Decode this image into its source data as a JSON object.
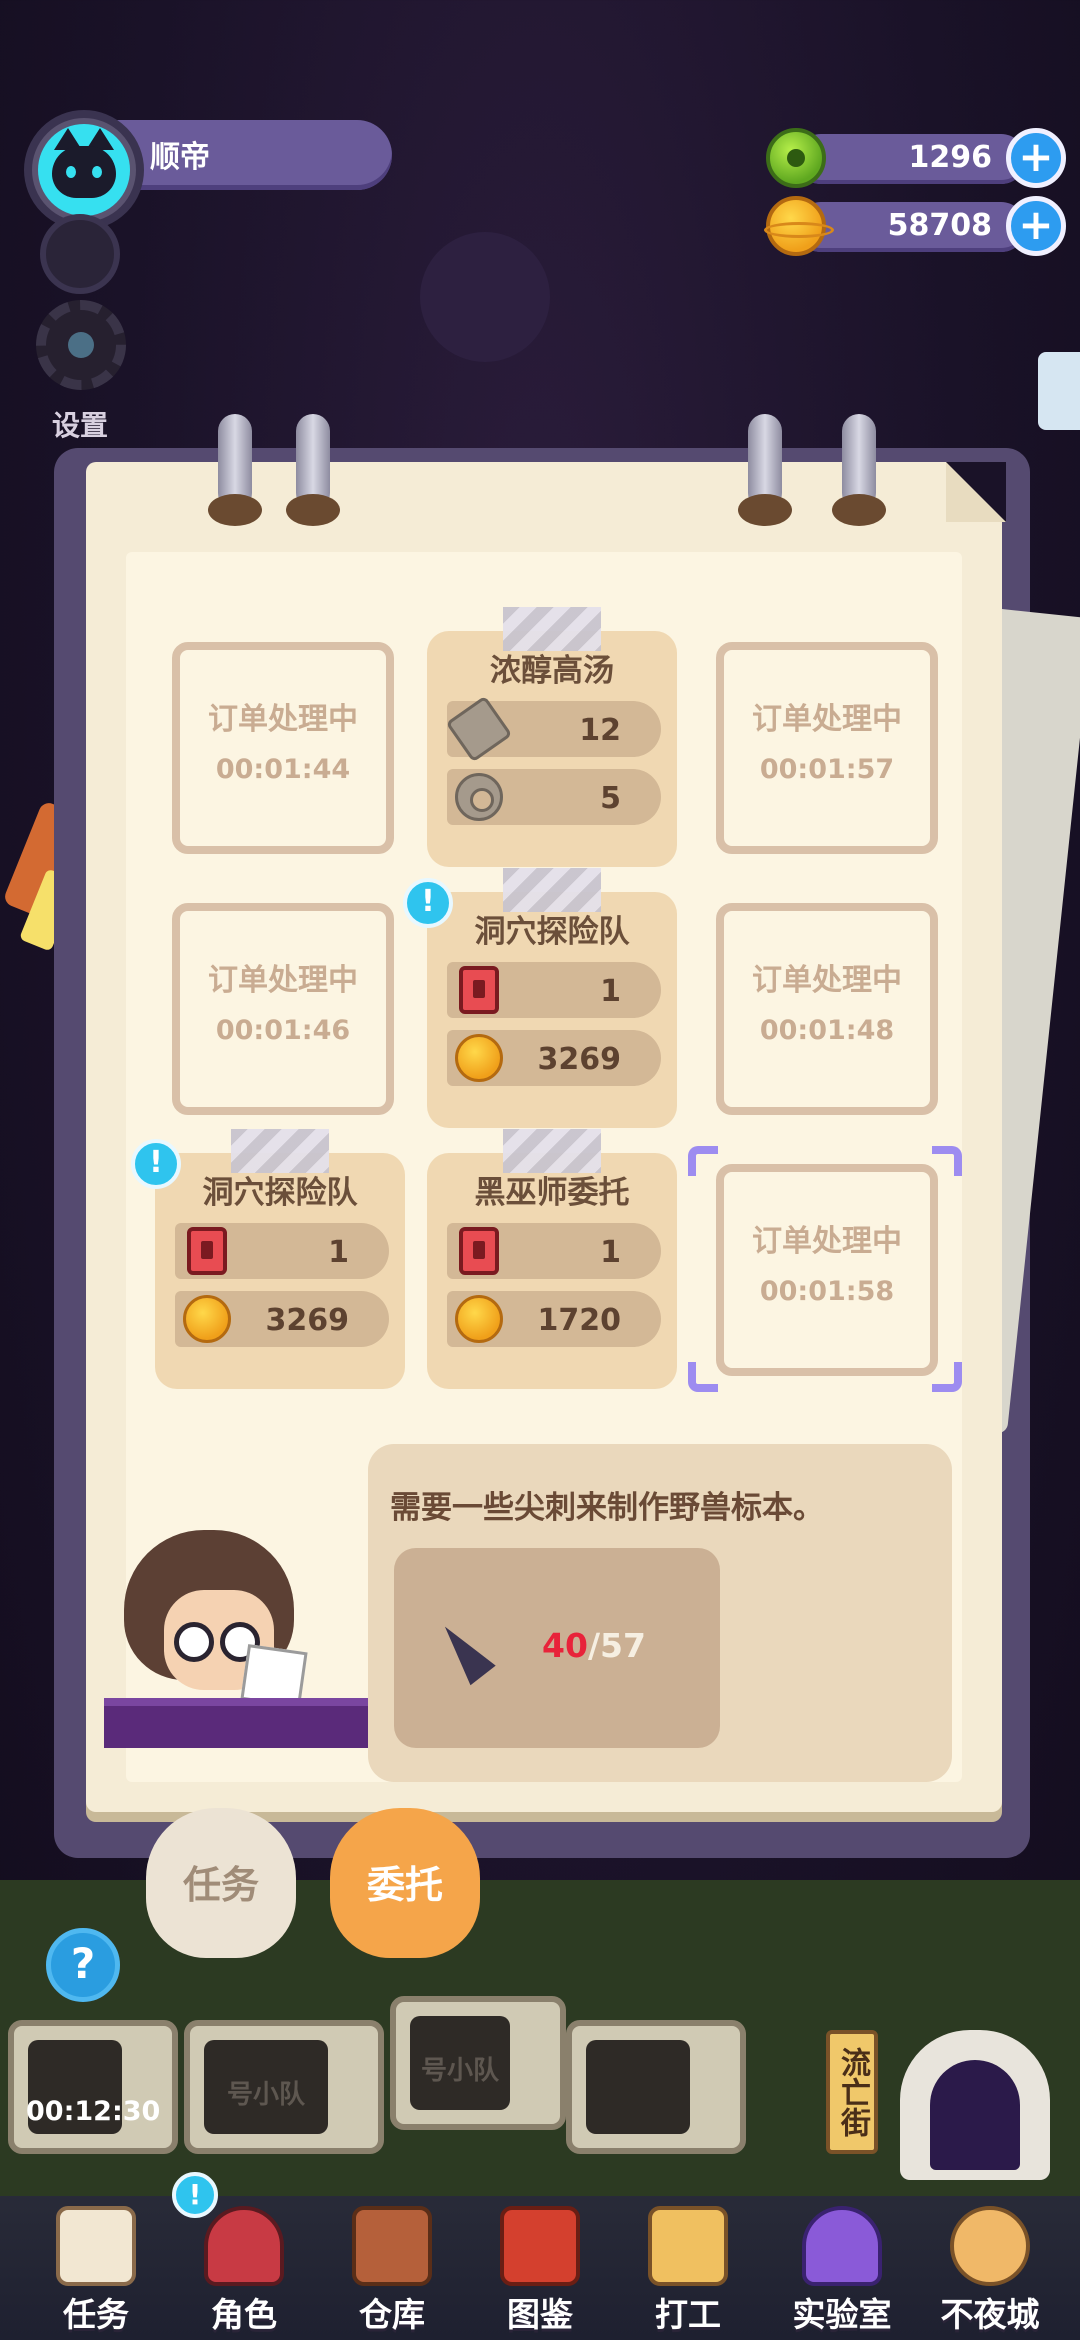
{
  "player": {
    "name": "顺帝"
  },
  "settings_label": "设置",
  "currencies": [
    {
      "name": "gear-token",
      "amount": "1296"
    },
    {
      "name": "gold-coin",
      "amount": "58708"
    }
  ],
  "orders": [
    {
      "state": "pending",
      "label": "订单处理中",
      "time": "00:01:44"
    },
    {
      "state": "active",
      "title": "浓醇高汤",
      "alert": false,
      "requirements": [
        {
          "icon": "bolt-icon",
          "qty": "12"
        },
        {
          "icon": "nut-icon",
          "qty": "5"
        }
      ]
    },
    {
      "state": "pending",
      "label": "订单处理中",
      "time": "00:01:57"
    },
    {
      "state": "pending",
      "label": "订单处理中",
      "time": "00:01:46"
    },
    {
      "state": "active",
      "title": "洞穴探险队",
      "alert": true,
      "requirements": [
        {
          "icon": "red-card-icon",
          "qty": "1"
        },
        {
          "icon": "gold-coin-icon",
          "qty": "3269"
        }
      ]
    },
    {
      "state": "pending",
      "label": "订单处理中",
      "time": "00:01:48"
    },
    {
      "state": "active",
      "title": "洞穴探险队",
      "alert": true,
      "requirements": [
        {
          "icon": "red-card-icon",
          "qty": "1"
        },
        {
          "icon": "gold-coin-icon",
          "qty": "3269"
        }
      ]
    },
    {
      "state": "active",
      "title": "黑巫师委托",
      "alert": false,
      "requirements": [
        {
          "icon": "red-card-icon",
          "qty": "1"
        },
        {
          "icon": "gold-coin-icon",
          "qty": "1720"
        }
      ]
    },
    {
      "state": "pending",
      "label": "订单处理中",
      "time": "00:01:58",
      "selected": true
    }
  ],
  "request": {
    "message": "需要一些尖刺来制作野兽标本。",
    "item_icon": "spike-icon",
    "have": "40",
    "separator": "/",
    "need": "57"
  },
  "tabs": [
    {
      "label": "任务",
      "active": false
    },
    {
      "label": "委托",
      "active": true
    }
  ],
  "alert_symbol": "!",
  "help_symbol": "?",
  "plus_symbol": "+",
  "world": {
    "timer": "00:12:30",
    "team_slots": [
      "号小队",
      "号小队"
    ],
    "street_sign": "流亡街"
  },
  "bottom_nav": [
    {
      "label": "任务",
      "icon": "task-icon"
    },
    {
      "label": "角色",
      "icon": "role-icon"
    },
    {
      "label": "仓库",
      "icon": "warehouse-icon"
    },
    {
      "label": "图鉴",
      "icon": "book-icon"
    },
    {
      "label": "打工",
      "icon": "work-icon"
    },
    {
      "label": "实验室",
      "icon": "lab-icon"
    },
    {
      "label": "不夜城",
      "icon": "city-icon"
    }
  ]
}
